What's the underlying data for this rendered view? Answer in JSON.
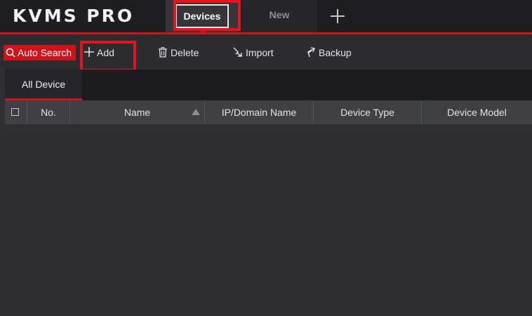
{
  "app": {
    "logo": "KVMS PRO"
  },
  "tabs": [
    {
      "label": "Devices",
      "active": true
    },
    {
      "label": "New",
      "active": false
    }
  ],
  "add_tab_icon": "plus-icon",
  "toolbar": {
    "auto_search": {
      "label": "Auto Search",
      "icon": "search-icon"
    },
    "add": {
      "label": "Add",
      "icon": "plus-icon"
    },
    "delete": {
      "label": "Delete",
      "icon": "trash-icon"
    },
    "import": {
      "label": "Import",
      "icon": "import-icon"
    },
    "backup": {
      "label": "Backup",
      "icon": "backup-icon"
    }
  },
  "device_tabs": [
    {
      "label": "All Device",
      "active": true
    }
  ],
  "table": {
    "columns": [
      "No.",
      "Name",
      "IP/Domain Name",
      "Device Type",
      "Device Model"
    ],
    "sort_column": "Name",
    "rows": []
  },
  "colors": {
    "accent": "#d0121b",
    "highlight_box": "#e5141f",
    "background": "#2d2f34"
  }
}
